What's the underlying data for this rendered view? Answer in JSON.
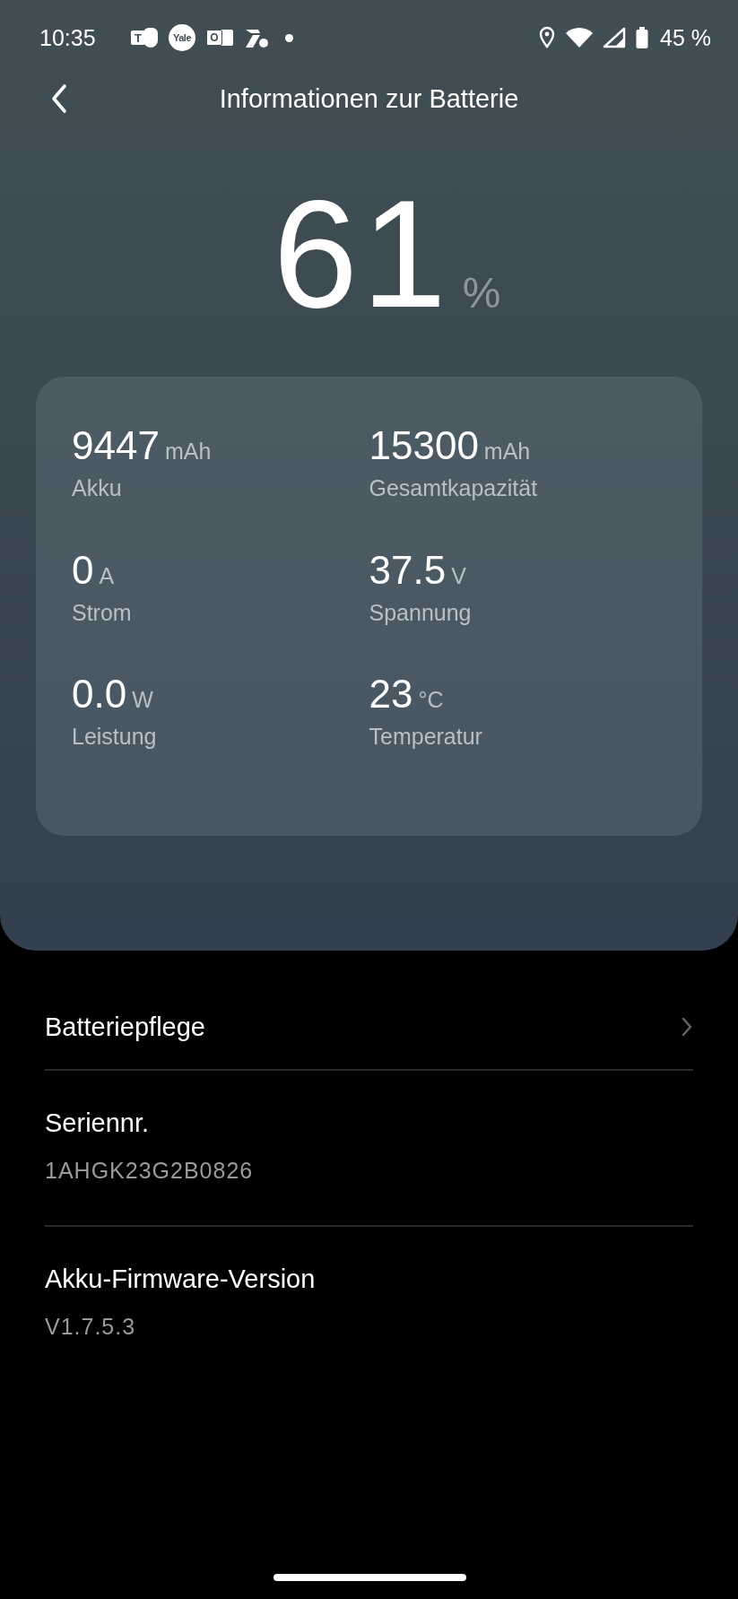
{
  "status_bar": {
    "time": "10:35",
    "notification_icons": [
      {
        "kind": "teams",
        "text": "T"
      },
      {
        "kind": "yale",
        "text": "Yale"
      },
      {
        "kind": "outlook",
        "text": "O"
      },
      {
        "kind": "app"
      },
      {
        "kind": "dot"
      }
    ],
    "battery": "45 %"
  },
  "header": {
    "title": "Informationen zur Batterie"
  },
  "charge": {
    "value": "61",
    "unit": "%"
  },
  "stats": [
    {
      "value": "9447",
      "unit": "mAh",
      "label": "Akku"
    },
    {
      "value": "15300",
      "unit": "mAh",
      "label": "Gesamtkapazität"
    },
    {
      "value": "0",
      "unit": "A",
      "label": "Strom"
    },
    {
      "value": "37.5",
      "unit": "V",
      "label": "Spannung"
    },
    {
      "value": "0.0",
      "unit": "W",
      "label": "Leistung"
    },
    {
      "value": "23",
      "unit": "°C",
      "label": "Temperatur"
    }
  ],
  "settings": [
    {
      "kind": "link",
      "title": "Batteriepflege"
    },
    {
      "kind": "info",
      "title": "Seriennr.",
      "value": "1AHGK23G2B0826"
    },
    {
      "kind": "info",
      "title": "Akku-Firmware-Version",
      "value": "V1.7.5.3"
    }
  ]
}
